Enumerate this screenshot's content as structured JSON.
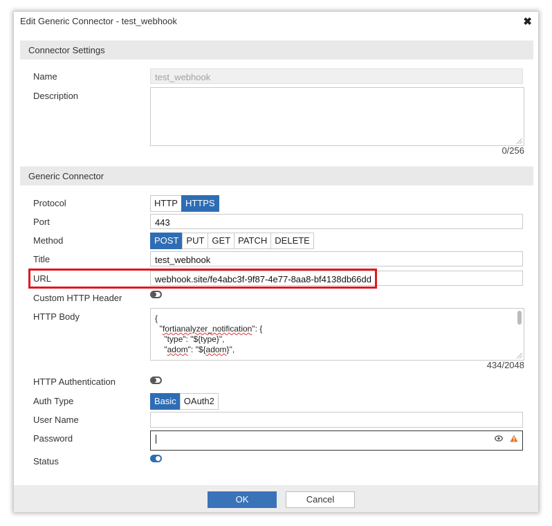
{
  "dialog": {
    "title": "Edit Generic Connector - test_webhook",
    "close_glyph": "✖"
  },
  "sections": {
    "connector_settings": "Connector Settings",
    "generic_connector": "Generic Connector"
  },
  "labels": {
    "name": "Name",
    "description": "Description",
    "protocol": "Protocol",
    "port": "Port",
    "method": "Method",
    "title": "Title",
    "url": "URL",
    "custom_http_header": "Custom HTTP Header",
    "http_body": "HTTP Body",
    "http_authentication": "HTTP Authentication",
    "auth_type": "Auth Type",
    "user_name": "User Name",
    "password": "Password",
    "status": "Status"
  },
  "fields": {
    "name": "test_webhook",
    "description": "",
    "description_counter": "0/256",
    "port": "443",
    "title": "test_webhook",
    "url": "webhook.site/fe4abc3f-9f87-4e77-8aa8-bf4138db66dd",
    "user_name": "",
    "password": ""
  },
  "protocol": {
    "options": [
      "HTTP",
      "HTTPS"
    ],
    "selected": "HTTPS"
  },
  "method": {
    "options": [
      "POST",
      "PUT",
      "GET",
      "PATCH",
      "DELETE"
    ],
    "selected": "POST"
  },
  "auth_type": {
    "options": [
      "Basic",
      "OAuth2"
    ],
    "selected": "Basic"
  },
  "toggles": {
    "custom_http_header": false,
    "http_authentication": false,
    "status": true
  },
  "http_body": {
    "line1": "{",
    "line2a": "  \"",
    "line2b": "fortianalyzer_notification",
    "line2c": "\": {",
    "line3": "    \"type\": \"${type}\",",
    "line4a": "    \"",
    "line4b": "adom",
    "line4c": "\": \"${",
    "line4d": "adom",
    "line4e": "}\",",
    "counter": "434/2048"
  },
  "footer": {
    "ok": "OK",
    "cancel": "Cancel"
  },
  "colors": {
    "accent": "#2e6db4",
    "highlight_border": "#e0171f",
    "warning": "#e8701a"
  }
}
